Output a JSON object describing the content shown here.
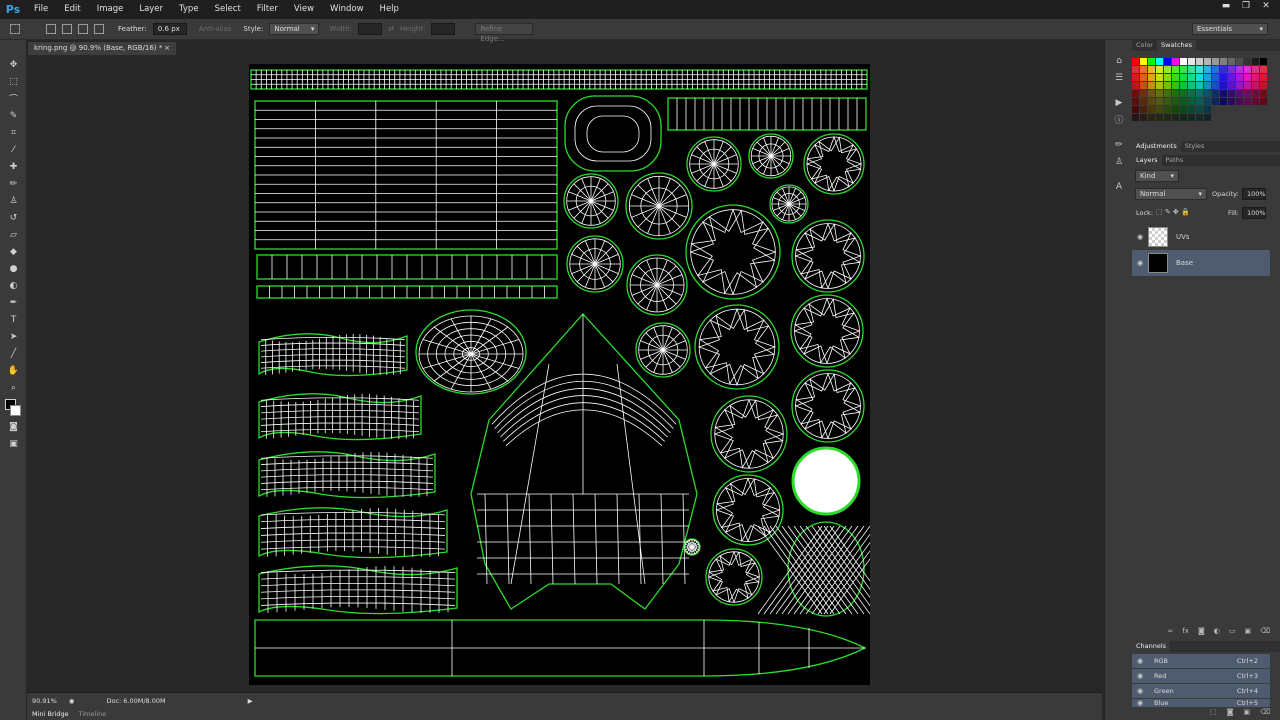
{
  "app": {
    "logo": "Ps"
  },
  "menu": [
    "File",
    "Edit",
    "Image",
    "Layer",
    "Type",
    "Select",
    "Filter",
    "View",
    "Window",
    "Help"
  ],
  "window_controls": {
    "minimize": "▬",
    "restore": "❐",
    "close": "✕"
  },
  "options": {
    "feather_label": "Feather:",
    "feather_value": "0.6 px",
    "antialias_label": "Anti-alias",
    "style_label": "Style:",
    "style_value": "Normal",
    "width_label": "Width:",
    "height_label": "Height:",
    "refine_label": "Refine Edge...",
    "workspace_value": "Essentials"
  },
  "document": {
    "tab_title": "kring.png @ 90.9% (Base, RGB/16) *",
    "close": "×"
  },
  "status": {
    "zoom": "90.91%",
    "doc_info": "Doc: 6.00M/8.00M"
  },
  "bottom_tabs": [
    "Mini Bridge",
    "Timeline"
  ],
  "color_panel": {
    "tabs": [
      "Color",
      "Swatches"
    ],
    "active": "Swatches"
  },
  "adjust_panel": {
    "tabs": [
      "Adjustments",
      "Styles"
    ]
  },
  "layers_panel": {
    "tabs": [
      "Layers",
      "Paths"
    ],
    "kind_label": "Kind",
    "blend_mode": "Normal",
    "opacity_label": "Opacity:",
    "opacity_value": "100%",
    "lock_label": "Lock:",
    "fill_label": "Fill:",
    "fill_value": "100%",
    "layers": [
      {
        "name": "UVs",
        "selected": false
      },
      {
        "name": "Base",
        "selected": true
      }
    ]
  },
  "channels_panel": {
    "title": "Channels",
    "channels": [
      {
        "name": "RGB",
        "shortcut": "Ctrl+2"
      },
      {
        "name": "Red",
        "shortcut": "Ctrl+3"
      },
      {
        "name": "Green",
        "shortcut": "Ctrl+4"
      },
      {
        "name": "Blue",
        "shortcut": "Ctrl+5"
      }
    ]
  },
  "colors": {
    "accent": "#3ca2e6",
    "uv_outline": "#2bdc2b",
    "uv_wire": "#ffffff",
    "selected_row": "#4f5b6e"
  }
}
